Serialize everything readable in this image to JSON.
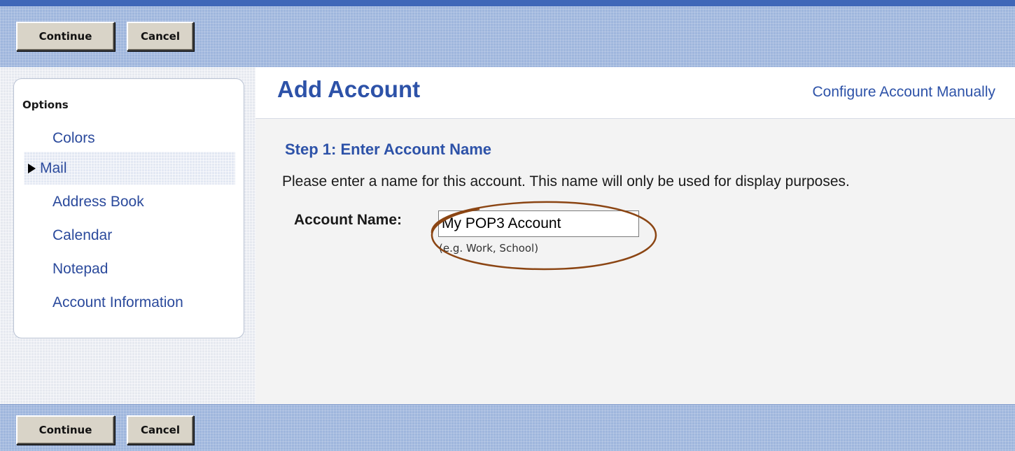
{
  "toolbar_top": {
    "continue_label": "Continue",
    "cancel_label": "Cancel"
  },
  "toolbar_bottom": {
    "continue_label": "Continue",
    "cancel_label": "Cancel"
  },
  "sidebar": {
    "title": "Options",
    "items": [
      {
        "label": "Colors",
        "active": false
      },
      {
        "label": "Mail",
        "active": true
      },
      {
        "label": "Address Book",
        "active": false
      },
      {
        "label": "Calendar",
        "active": false
      },
      {
        "label": "Notepad",
        "active": false
      },
      {
        "label": "Account Information",
        "active": false
      }
    ]
  },
  "header": {
    "title": "Add Account",
    "configure_link": "Configure Account Manually"
  },
  "step": {
    "heading": "Step 1: Enter Account Name",
    "description": "Please enter a name for this account. This name will only be used for display purposes.",
    "field_label": "Account Name:",
    "field_value": "My POP3 Account",
    "field_hint": "(e.g. Work, School)"
  },
  "colors": {
    "toolbar": "#9fb6dd",
    "accent_blue": "#2d52a8",
    "highlight_ellipse": "#8b4513"
  },
  "icons": {
    "active_item_marker": "right-triangle-arrow-icon"
  }
}
